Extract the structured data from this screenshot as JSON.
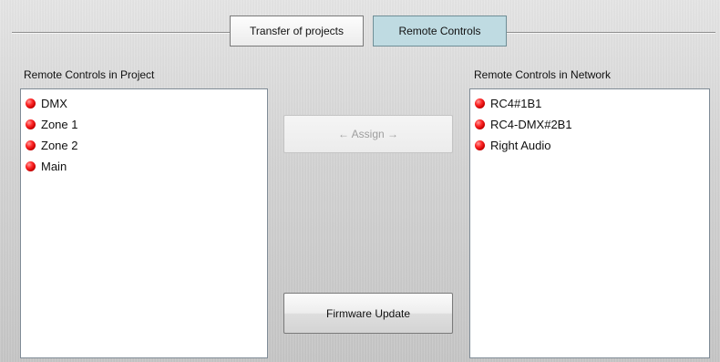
{
  "tabs": [
    {
      "label": "Transfer of projects",
      "active": false
    },
    {
      "label": "Remote Controls",
      "active": true
    }
  ],
  "project_panel": {
    "label": "Remote Controls in Project",
    "items": [
      "DMX",
      "Zone 1",
      "Zone 2",
      "Main"
    ]
  },
  "network_panel": {
    "label": "Remote Controls in Network",
    "items": [
      "RC4#1B1",
      "RC4-DMX#2B1",
      "Right Audio"
    ]
  },
  "buttons": {
    "assign_label": "← Assign →",
    "assign_enabled": false,
    "firmware_label": "Firmware Update"
  },
  "colors": {
    "active_tab": "#bfdbe2",
    "status_led": "#e00000",
    "disabled_text": "#9e9e9e"
  },
  "icons": {
    "status_indicator": "red-led-icon"
  }
}
